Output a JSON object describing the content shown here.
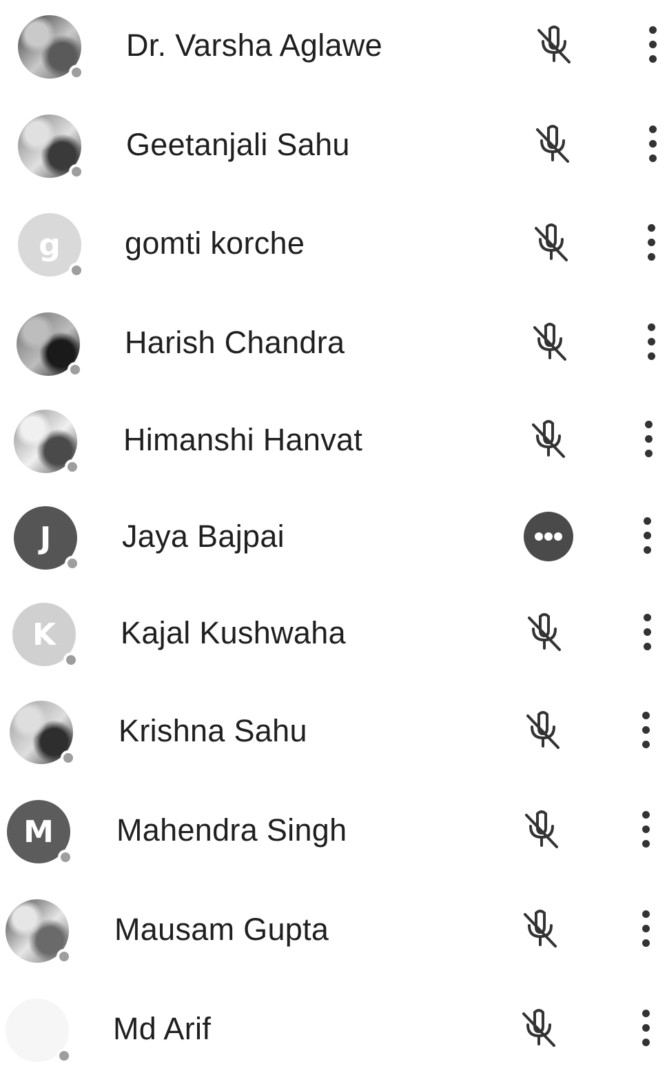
{
  "participants": [
    {
      "name": "Dr. Varsha Aglawe",
      "avatar": {
        "kind": "photo",
        "colors": [
          "#5a5a5a",
          "#c9c9c9",
          "#2f2f2f"
        ]
      },
      "status_icon": "mic-off-icon"
    },
    {
      "name": "Geetanjali Sahu",
      "avatar": {
        "kind": "photo",
        "colors": [
          "#3a3a3a",
          "#e0e0e0",
          "#7a7a7a"
        ]
      },
      "status_icon": "mic-off-icon"
    },
    {
      "name": "gomti korche",
      "avatar": {
        "kind": "letter",
        "letter": "g",
        "color": "#d9d9d9"
      },
      "status_icon": "mic-off-icon"
    },
    {
      "name": "Harish Chandra",
      "avatar": {
        "kind": "photo",
        "colors": [
          "#1a1a1a",
          "#bdbdbd",
          "#6a6a6a"
        ]
      },
      "status_icon": "mic-off-icon"
    },
    {
      "name": "Himanshi Hanvat",
      "avatar": {
        "kind": "photo",
        "colors": [
          "#4a4a4a",
          "#f0f0f0",
          "#8a8a8a"
        ]
      },
      "status_icon": "mic-off-icon"
    },
    {
      "name": "Jaya Bajpai",
      "avatar": {
        "kind": "letter",
        "letter": "J",
        "color": "#555555"
      },
      "status_icon": "more-horizontal-icon"
    },
    {
      "name": "Kajal Kushwaha",
      "avatar": {
        "kind": "letter",
        "letter": "K",
        "color": "#d0d0d0"
      },
      "status_icon": "mic-off-icon"
    },
    {
      "name": "Krishna Sahu",
      "avatar": {
        "kind": "photo",
        "colors": [
          "#2e2e2e",
          "#dedede",
          "#9a9a9a"
        ]
      },
      "status_icon": "mic-off-icon"
    },
    {
      "name": "Mahendra Singh",
      "avatar": {
        "kind": "letter",
        "letter": "M",
        "color": "#5c5c5c"
      },
      "status_icon": "mic-off-icon"
    },
    {
      "name": "Mausam Gupta",
      "avatar": {
        "kind": "photo",
        "colors": [
          "#6a6a6a",
          "#e6e6e6",
          "#3a3a3a"
        ]
      },
      "status_icon": "mic-off-icon"
    },
    {
      "name": "Md Arif",
      "avatar": {
        "kind": "blank",
        "color": "#f6f6f6"
      },
      "status_icon": "mic-off-icon"
    }
  ],
  "colors": {
    "text": "#1f1f1f",
    "icon": "#333333",
    "status_dot": "#9e9e9e",
    "background": "#ffffff"
  }
}
